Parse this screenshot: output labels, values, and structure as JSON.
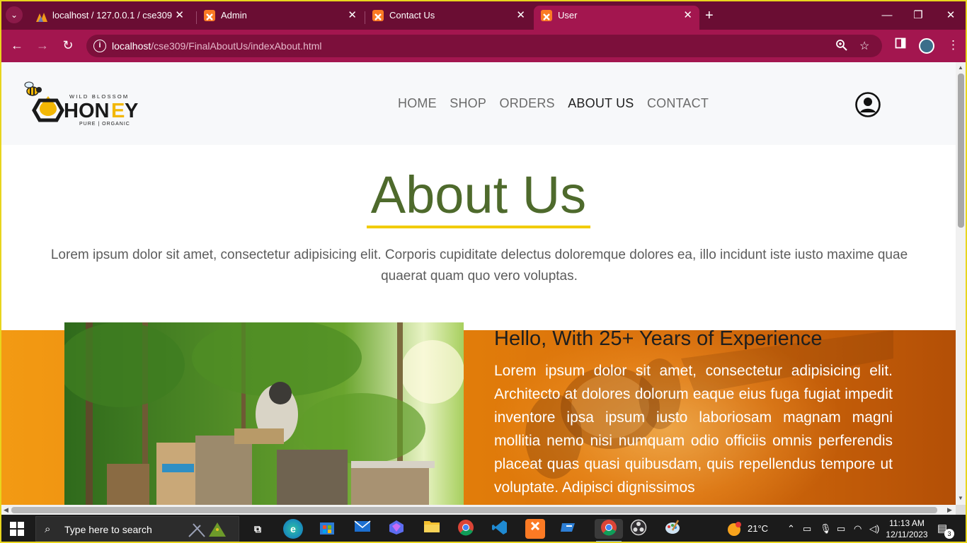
{
  "browser": {
    "tabs": [
      {
        "title": "localhost / 127.0.0.1 / cse309 / ",
        "favicon": "phpmyadmin-icon",
        "active": false
      },
      {
        "title": "Admin",
        "favicon": "xampp-icon",
        "active": false
      },
      {
        "title": "Contact Us",
        "favicon": "xampp-icon",
        "active": false
      },
      {
        "title": "User",
        "favicon": "xampp-icon",
        "active": true
      }
    ],
    "url_host": "localhost",
    "url_path": "/cse309/FinalAboutUs/indexAbout.html",
    "accent_color": "#a3164f",
    "tabstrip_color": "#6a0d33"
  },
  "site": {
    "logo": {
      "small": "WILD BLOSSOM",
      "big": "HONEY",
      "tag": "PURE | ORGANIC"
    },
    "nav": [
      "HOME",
      "SHOP",
      "ORDERS",
      "ABOUT US",
      "CONTACT"
    ],
    "active_nav": "ABOUT US",
    "about_title": "About Us",
    "about_text": "Lorem ipsum dolor sit amet, consectetur adipisicing elit. Corporis cupiditate delectus doloremque dolores ea, illo incidunt iste iusto maxime quae quaerat quam quo vero voluptas.",
    "experience_title": "Hello, With 25+ Years of Experience",
    "experience_text": "Lorem ipsum dolor sit amet, consectetur adipisicing elit. Architecto at dolores dolorum eaque eius fuga fugiat impedit inventore ipsa ipsum iusto laboriosam magnam magni mollitia nemo nisi numquam odio officiis omnis perferendis placeat quas quasi quibusdam, quis repellendus tempore ut voluptate. Adipisci dignissimos",
    "title_color": "#4e6a2c",
    "underline_color": "#f2cc00"
  },
  "taskbar": {
    "search_placeholder": "Type here to search",
    "weather": "21°C",
    "time": "11:13 AM",
    "date": "12/11/2023",
    "notifications": "3"
  }
}
